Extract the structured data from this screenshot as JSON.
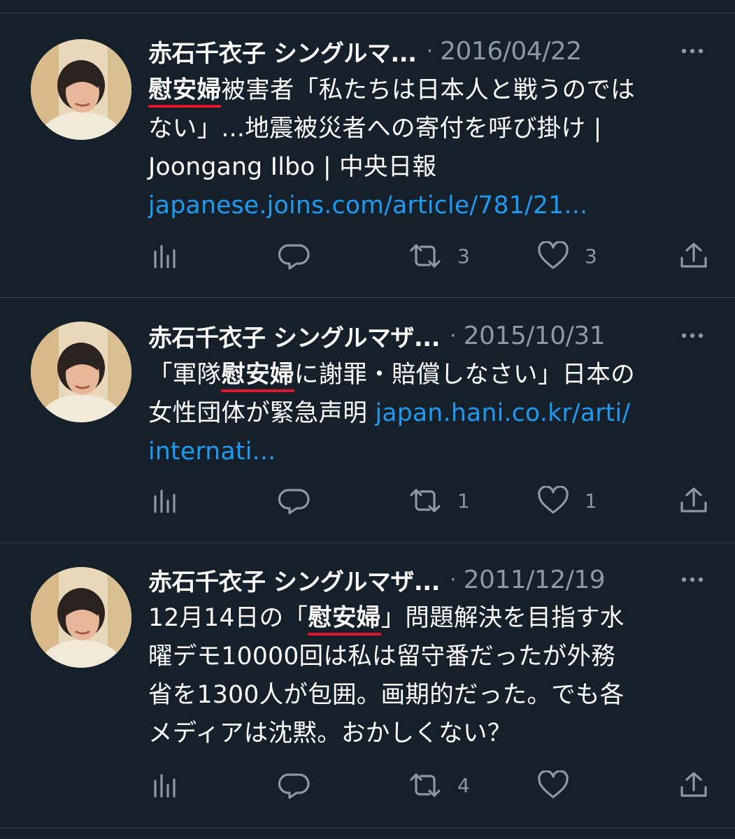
{
  "tweets": [
    {
      "author": "赤石千衣子 シングルマ...",
      "separator": "·",
      "date": "2016/04/22",
      "text_lines": [
        [
          "",
          "慰安婦",
          "被害者「私たちは日本人と戦うのではない」...地震被災者への寄付を呼び掛け |"
        ],
        [
          "Joongang Ilbo | 中央日報",
          "",
          ""
        ]
      ],
      "text_line1_highlight": "慰安婦",
      "text_line1_rest": "被害者「私たちは日本人と戦うのでは",
      "text_line2": "ない」...地震被災者への寄付を呼び掛け |",
      "text_line3": "Joongang Ilbo | 中央日報",
      "link": "japanese.joins.com/article/781/21...",
      "retweets": "3",
      "likes": "3"
    },
    {
      "author": "赤石千衣子 シングルマザ...",
      "separator": "·",
      "date": "2015/10/31",
      "text_line1_pre": "「軍隊",
      "text_line1_highlight": "慰安婦",
      "text_line1_rest": "に謝罪・賠償しなさい」日本の",
      "text_line2": "女性団体が緊急声明 ",
      "link_line2": "japan.hani.co.kr/arti/",
      "link_line3": "internati...",
      "retweets": "1",
      "likes": "1"
    },
    {
      "author": "赤石千衣子 シングルマザ...",
      "separator": "·",
      "date": "2011/12/19",
      "text_line1_pre": "12月14日の「",
      "text_line1_highlight": "慰安婦",
      "text_line1_rest": "」問題解決を目指す水",
      "text_line2": "曜デモ10000回は私は留守番だったが外務",
      "text_line3": "省を1300人が包囲。画期的だった。でも各",
      "text_line4": "メディアは沈黙。おかしくない？",
      "retweets": "4",
      "likes": ""
    }
  ],
  "colors": {
    "background": "#15202b",
    "muted": "#8b98a5",
    "link": "#1d9bf0",
    "highlight_underline": "#e0162b",
    "divider": "#38444d"
  },
  "icons": [
    "analytics-icon",
    "reply-icon",
    "retweet-icon",
    "like-icon",
    "share-icon",
    "more-icon"
  ]
}
